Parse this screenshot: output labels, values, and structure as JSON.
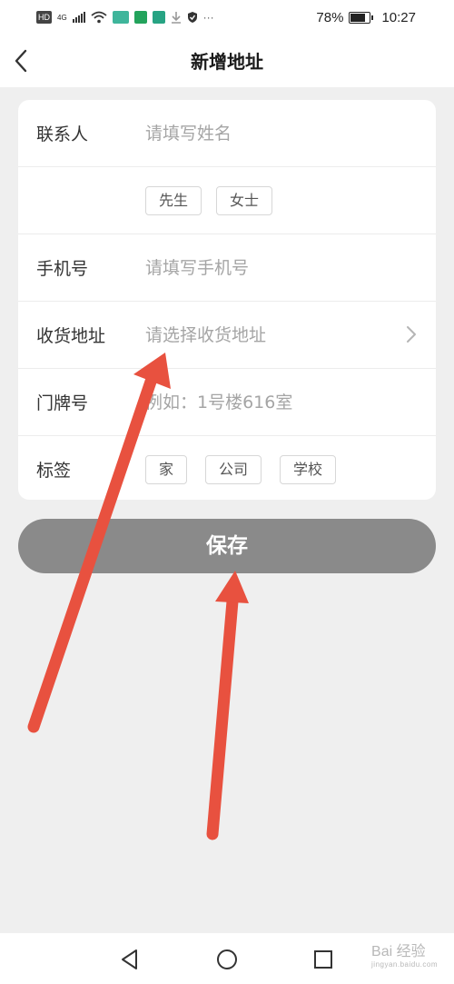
{
  "status_bar": {
    "hd": "HD",
    "network": "4G",
    "battery": "78%",
    "battery_level": 0.78,
    "time": "10:27"
  },
  "header": {
    "title": "新增地址"
  },
  "form": {
    "contact": {
      "label": "联系人",
      "placeholder": "请填写姓名"
    },
    "salutations": [
      "先生",
      "女士"
    ],
    "phone": {
      "label": "手机号",
      "placeholder": "请填写手机号"
    },
    "address": {
      "label": "收货地址",
      "placeholder": "请选择收货地址"
    },
    "house_number": {
      "label": "门牌号",
      "placeholder": "例如：1号楼616室"
    },
    "tags": {
      "label": "标签",
      "options": [
        "家",
        "公司",
        "学校"
      ]
    }
  },
  "save_button": {
    "label": "保存"
  },
  "watermark": {
    "text": "Bai 经验",
    "sub": "jingyan.baidu.com"
  },
  "colors": {
    "background": "#efefef",
    "card": "#ffffff",
    "save_button": "#8a8a8a",
    "annotation_arrow": "#e8513f"
  }
}
